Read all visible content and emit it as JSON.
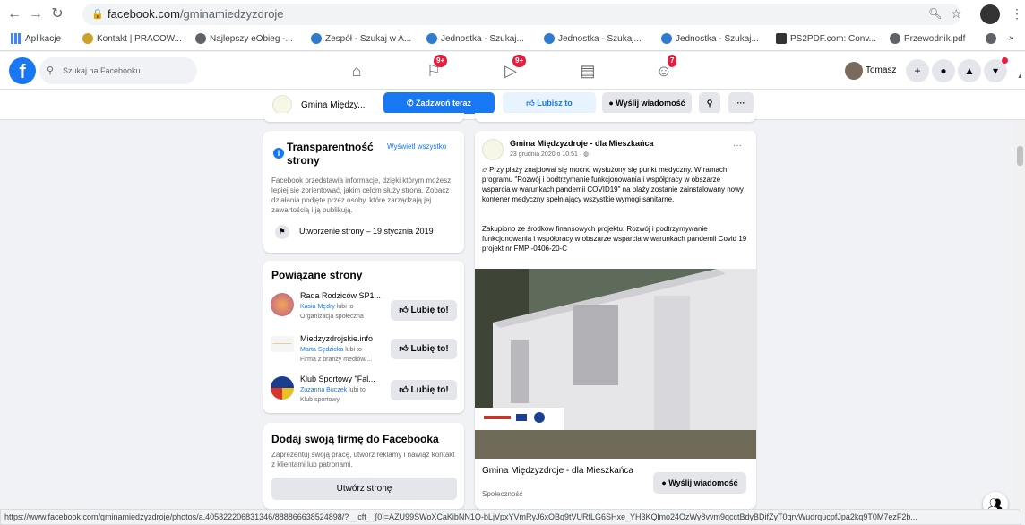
{
  "browser": {
    "url_domain": "facebook.com",
    "url_path": "/gminamiedzyzdroje",
    "bookmarks": [
      "Aplikacje",
      "Kontakt | PRACOW...",
      "Najlepszy eObieg -...",
      "Zespół - Szukaj w A...",
      "Jednostka - Szukaj...",
      "Jednostka - Szukaj...",
      "Jednostka - Szukaj...",
      "PS2PDF.com: Conv...",
      "Przewodnik.pdf"
    ],
    "bookmarks_more": "»",
    "status_url": "https://www.facebook.com/gminamiedzyzdroje/photos/a.405822206831346/888866638524898/?__cft__[0]=AZU99SWoXCaKibNN1Q-bLjVpxYVmRyJ6xOBq9tVURfLG6SHxe_YH3KQlmo24OzWy8vvm9qcctBdyBDifZyT0grvWudrqucpfJpa2kq9T0M7ezF2b..."
  },
  "fb": {
    "logo": "f",
    "search_placeholder": "Szukaj na Facebooku",
    "badges": [
      "9+",
      "9+",
      "7"
    ],
    "user_name": "Tomasz"
  },
  "page_header": {
    "name": "Gmina Między...",
    "call": "Zadzwoń teraz",
    "like": "Lubisz to",
    "message": "Wyślij wiadomość",
    "more": "···"
  },
  "transparency": {
    "title": "Transparentność strony",
    "see_all": "Wyświetl wszystko",
    "description": "Facebook przedstawia informacje, dzięki którym możesz lepiej się zorientować, jakim celom służy strona. Zobacz działania podjęte przez osoby, które zarządzają jej zawartością i ją publikują.",
    "created": "Utworzenie strony – 19 stycznia 2019"
  },
  "related": {
    "title": "Powiązane strony",
    "like_label": "Lubię to!",
    "items": [
      {
        "name": "Rada Rodziców SP1...",
        "liker": "Kasia Mędry",
        "likes_text": "lubi to",
        "category": "Organizacja społeczna"
      },
      {
        "name": "Miedzyzdrojskie.info",
        "liker": "Marta Sędzicka",
        "likes_text": "lubi to",
        "category": "Firma z branży mediów/..."
      },
      {
        "name": "Klub Sportowy \"Fal...",
        "liker": "Zuzanna Buczek",
        "likes_text": "lubi to",
        "category": "Klub sportowy"
      }
    ]
  },
  "add_business": {
    "title": "Dodaj swoją firmę do Facebooka",
    "description": "Zaprezentuj swoją pracę, utwórz reklamy i nawiąż kontakt z klientami lub patronami.",
    "button": "Utwórz stronę"
  },
  "post": {
    "author": "Gmina Międzyzdroje - dla Mieszkańca",
    "date": "23 grudnia 2020 o 10:51 ·",
    "more": "···",
    "text1": "Przy plaży znajdował się mocno wysłużony się punkt medyczny. W ramach programu \"Rozwój i podtrzymanie funkcjonowania i współpracy w obszarze wsparcia w warunkach pandemii COVID19\" na plaży zostanie zainstalowany nowy kontener medyczny spełniający wszystkie wymogi sanitarne.",
    "text2": "Zakupiono ze środków finansowych projektu: Rozwój i podtrzymywanie funkcjonowania i współpracy w obszarze wsparcia w warunkach pandemii Covid 19 projekt nr FMP -0406-20-C",
    "footer_name": "Gmina Międzyzdroje - dla Mieszkańca",
    "footer_category": "Społeczność",
    "footer_button": "Wyślij wiadomość"
  },
  "colors": {
    "fb_blue": "#1877f2",
    "badge_red": "#e41e3f",
    "bg": "#f0f2f5"
  }
}
